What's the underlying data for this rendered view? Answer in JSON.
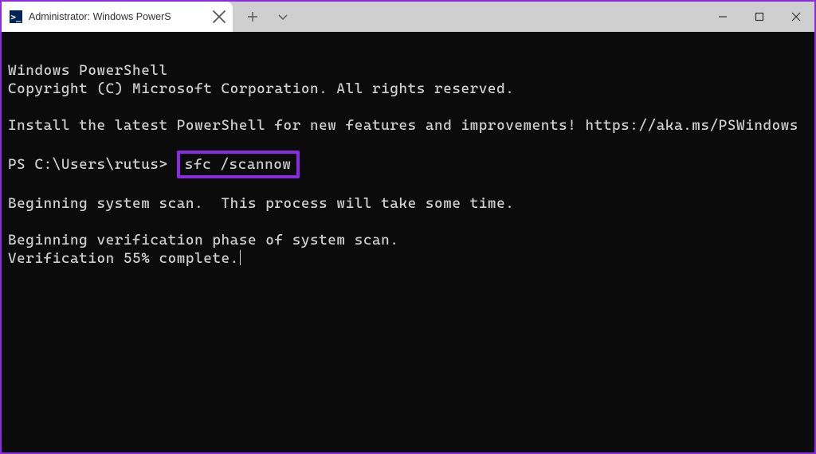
{
  "titlebar": {
    "tab_icon_text": ">_",
    "tab_title": "Administrator: Windows PowerS",
    "new_tab_tooltip": "New tab",
    "dropdown_tooltip": "Profiles"
  },
  "window_controls": {
    "minimize": "Minimize",
    "maximize": "Maximize",
    "close": "Close"
  },
  "terminal": {
    "line1": "Windows PowerShell",
    "line2": "Copyright (C) Microsoft Corporation. All rights reserved.",
    "line3": "Install the latest PowerShell for new features and improvements! https://aka.ms/PSWindows",
    "prompt": "PS C:\\Users\\rutus> ",
    "command": "sfc /scannow",
    "line5": "Beginning system scan.  This process will take some time.",
    "line6": "Beginning verification phase of system scan.",
    "line7": "Verification 55% complete."
  },
  "colors": {
    "highlight_border": "#8a2be2",
    "terminal_bg": "#0b0b0b",
    "terminal_fg": "#cfcfcf",
    "ps_icon_bg": "#012456"
  }
}
